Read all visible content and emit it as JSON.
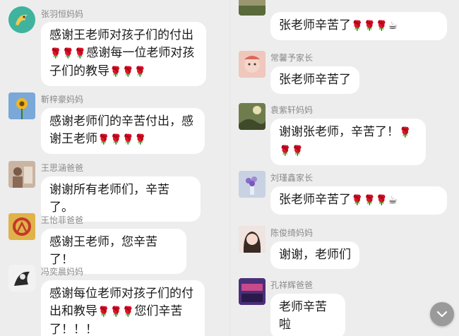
{
  "left": [
    {
      "name": "张羽恒妈妈",
      "avatar_icon": "cartoon-dolphin-avatar",
      "avatar_color": "#45b8a6",
      "bubble": "感谢王老师对孩子们的付出🌹🌹🌹感谢每一位老师对孩子们的教导🌹🌹🌹"
    },
    {
      "name": "靳梓豪妈妈",
      "avatar_icon": "sunflower-photo-avatar",
      "avatar_color": "#6b9bd0",
      "bubble": "感谢老师们的辛苦付出，感谢王老师🌹🌹🌹🌹"
    },
    {
      "name": "王思涵爸爸",
      "avatar_icon": "photo-avatar",
      "avatar_color": "#b79a83",
      "bubble": "谢谢所有老师们，辛苦了。"
    },
    {
      "name": "王怡菲爸爸",
      "avatar_icon": "red-emblem-avatar",
      "avatar_color": "#d4a23a",
      "bubble": "感谢王老师，您辛苦了！"
    },
    {
      "name": "冯奕晨妈妈",
      "avatar_icon": "sketch-photo-avatar",
      "avatar_color": "#cfcfcf",
      "bubble": "感谢每位老师对孩子们的付出和教导🌹🌹🌹您们辛苦了！！！"
    }
  ],
  "right": [
    {
      "name": "",
      "avatar_icon": "landscape-photo-avatar",
      "avatar_color": "#8c8a6a",
      "bubble": "张老师辛苦了🌹🌹🌹☕"
    },
    {
      "name": "常馨予家长",
      "avatar_icon": "baby-photo-avatar",
      "avatar_color": "#e8b7ad",
      "bubble": "张老师辛苦了"
    },
    {
      "name": "袁紫轩妈妈",
      "avatar_icon": "nature-photo-avatar",
      "avatar_color": "#6a7a4a",
      "bubble": "谢谢张老师，辛苦了！🌹🌹🌹"
    },
    {
      "name": "刘瑾鑫家长",
      "avatar_icon": "flower-vase-photo-avatar",
      "avatar_color": "#b9c4d6",
      "bubble": "张老师辛苦了🌹🌹🌹☕"
    },
    {
      "name": "陈俊绮妈妈",
      "avatar_icon": "portrait-photo-avatar",
      "avatar_color": "#d8a7a0",
      "bubble": "谢谢，老师们"
    },
    {
      "name": "孔祥辉爸爸",
      "avatar_icon": "stage-photo-avatar",
      "avatar_color": "#5a3a8a",
      "bubble": "老师辛苦啦"
    }
  ],
  "scroll_icon": "chevron-down-icon",
  "flower_color": "#c63a2c"
}
